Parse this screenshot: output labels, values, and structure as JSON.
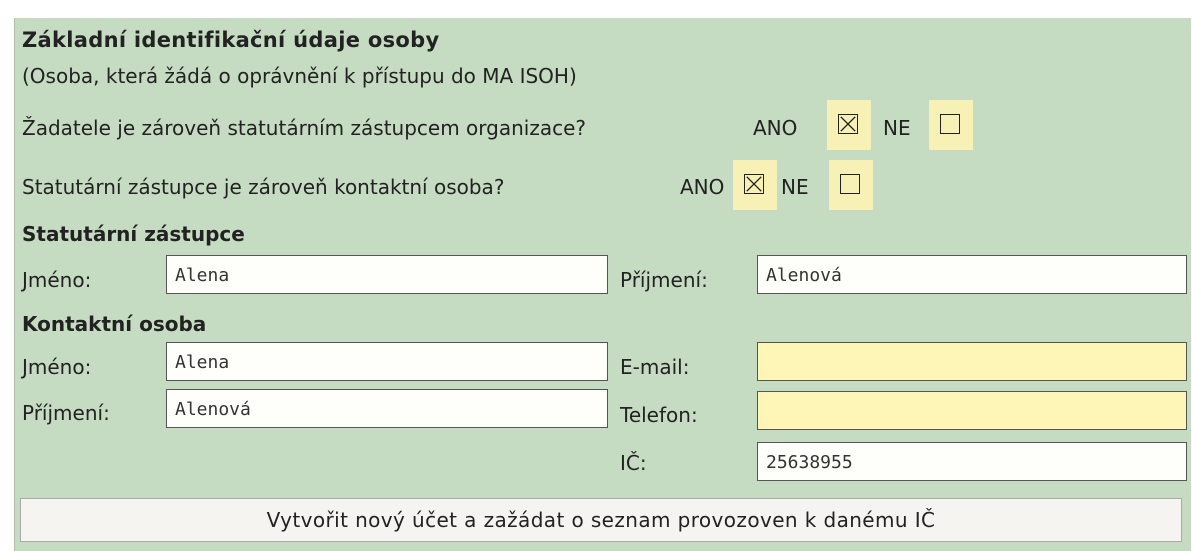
{
  "heading": "Základní identifikační údaje osoby",
  "subheading": "(Osoba, která žádá o oprávnění k přístupu do MA ISOH)",
  "question1": {
    "text": "Žadatele je zároveň statutárním zástupcem organizace?",
    "yes_label": "ANO",
    "no_label": "NE",
    "yes_checked": true,
    "no_checked": false
  },
  "question2": {
    "text": "Statutární zástupce je zároveň kontaktní osoba?",
    "yes_label": "ANO",
    "no_label": "NE",
    "yes_checked": true,
    "no_checked": false
  },
  "statutory": {
    "section_title": "Statutární zástupce",
    "first_name_label": "Jméno:",
    "first_name_value": "Alena",
    "last_name_label": "Příjmení:",
    "last_name_value": "Alenová"
  },
  "contact": {
    "section_title": "Kontaktní osoba",
    "first_name_label": "Jméno:",
    "first_name_value": "Alena",
    "last_name_label": "Příjmení:",
    "last_name_value": "Alenová",
    "email_label": "E-mail:",
    "email_value": "",
    "phone_label": "Telefon:",
    "phone_value": "",
    "ic_label": "IČ:",
    "ic_value": "25638955"
  },
  "submit_label": "Vytvořit nový účet a zažádat o seznam provozoven k danému IČ",
  "colors": {
    "panel": "#c6dcc2",
    "highlight": "#fdf6b6",
    "field": "#fefefb"
  }
}
